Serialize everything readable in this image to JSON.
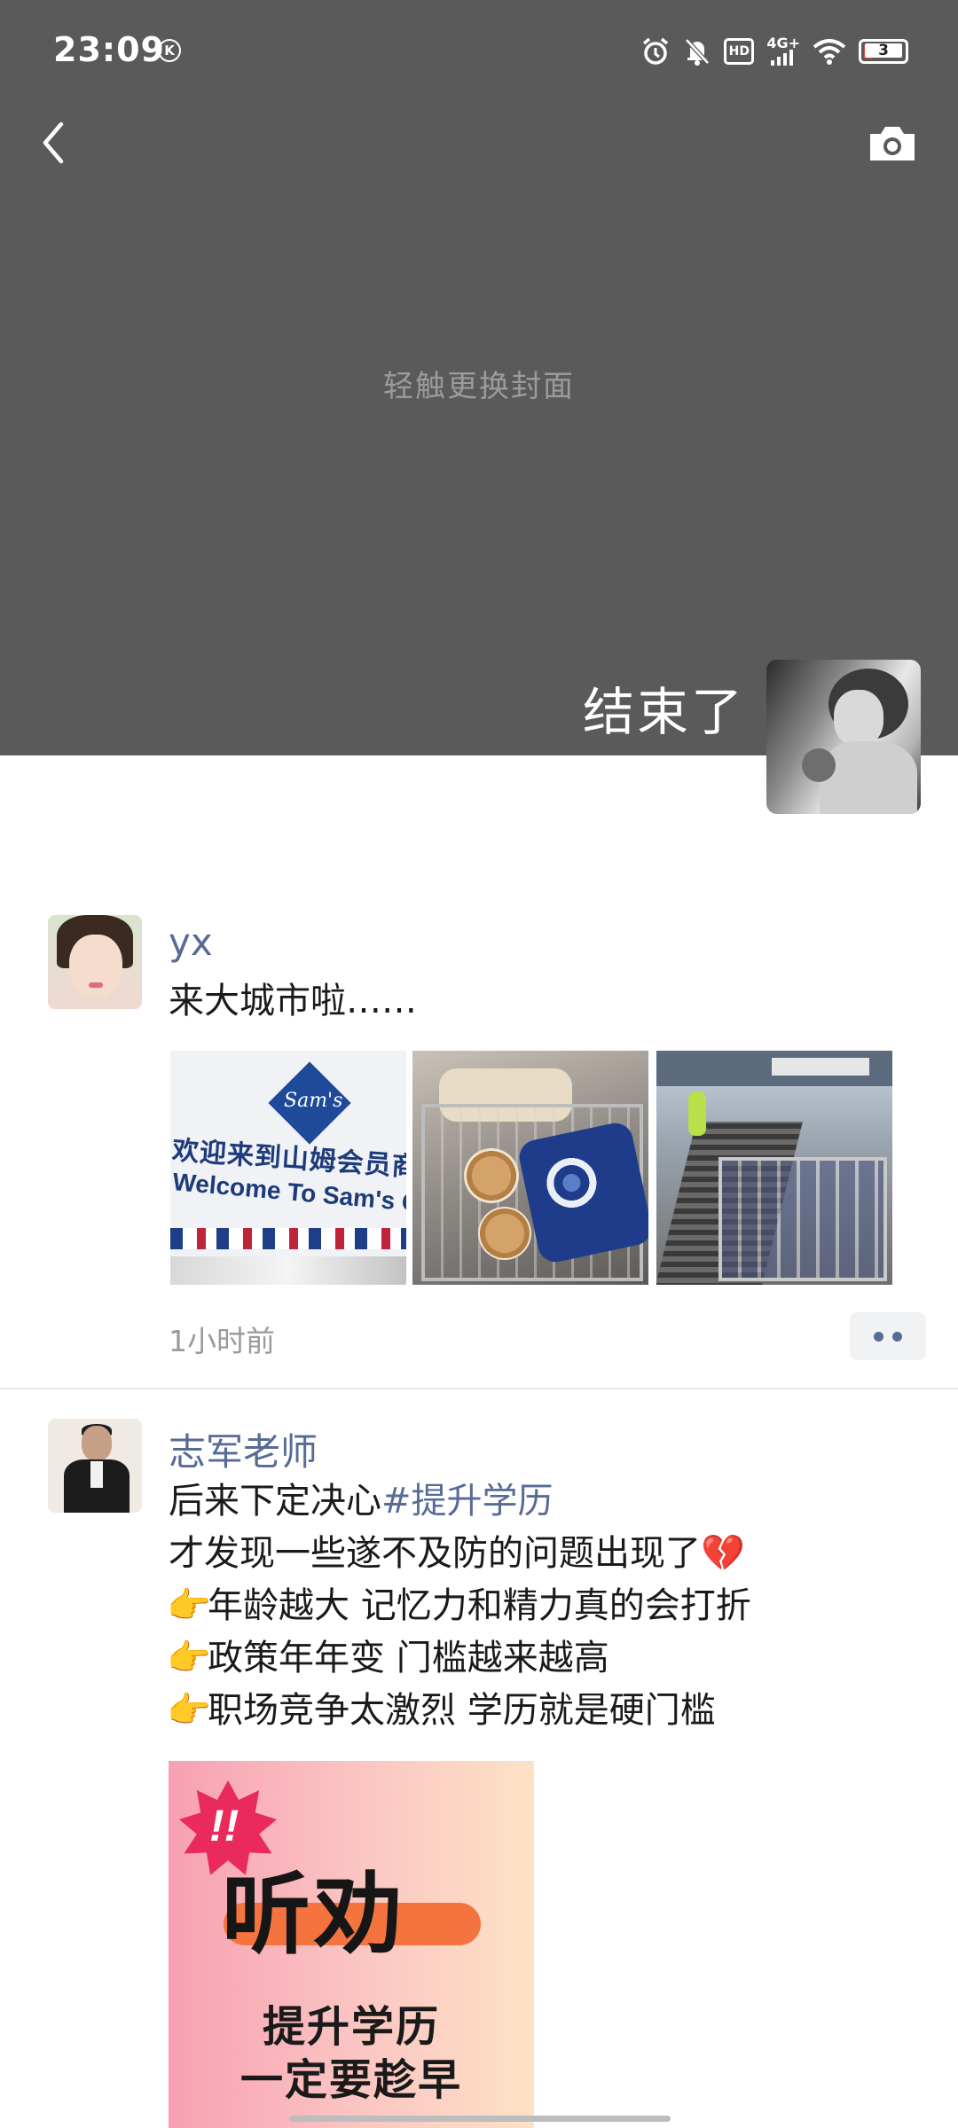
{
  "status_bar": {
    "time": "23:09",
    "k_badge": "K",
    "hd": "HD",
    "network": "4G+",
    "battery": "3"
  },
  "cover": {
    "hint": "轻触更换封面",
    "username": "结束了"
  },
  "icons": {
    "back": "chevron-left-icon",
    "camera": "camera-icon",
    "alarm": "alarm-icon",
    "mute": "bell-off-icon",
    "wifi": "wifi-icon",
    "battery": "battery-icon",
    "more": "more-dots-icon"
  },
  "posts": [
    {
      "author": "yx",
      "text": "来大城市啦……",
      "time_ago": "1小时前",
      "images": [
        {
          "logo": "Sam's",
          "sign_cn": "欢迎来到山姆会员商店",
          "sign_en": "Welcome To Sam's Club"
        },
        {},
        {}
      ]
    },
    {
      "author": "志军老师",
      "line1_text": "后来下定决心",
      "line1_tag": "#提升学历",
      "line2": "才发现一些遂不及防的问题出现了",
      "line2_emoji": "💔",
      "bullet_emoji": "👉",
      "line3": "年龄越大 记忆力和精力真的会打折",
      "line4": "政策年年变 门槛越来越高",
      "line5": "职场竞争太激烈 学历就是硬门槛",
      "image": {
        "burst": "!!",
        "headline": "听劝",
        "line1": "提升学历",
        "line2": "一定要趁早"
      }
    }
  ],
  "colors": {
    "cover_bg": "#5a5a5a",
    "link_blue": "#576b95",
    "divider": "#e8e8e8"
  }
}
